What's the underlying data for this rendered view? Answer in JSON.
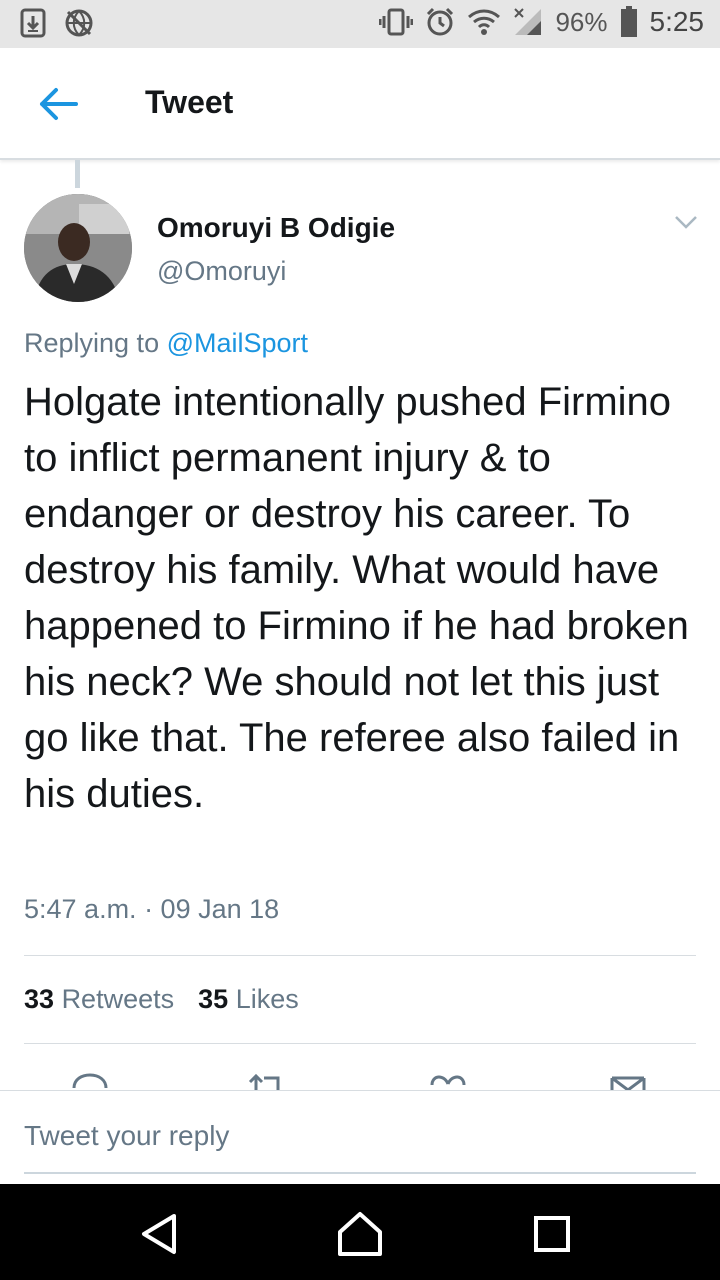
{
  "status_bar": {
    "battery": "96%",
    "time": "5:25",
    "icons": [
      "download-box-icon",
      "no-sim-globe-icon",
      "vibrate-icon",
      "alarm-icon",
      "wifi-icon",
      "signal-icon",
      "battery-icon"
    ]
  },
  "header": {
    "title": "Tweet",
    "back_icon": "arrow-left-icon"
  },
  "tweet": {
    "author_name": "Omoruyi B Odigie",
    "author_handle": "@Omoruyi",
    "replying_prefix": "Replying to ",
    "replying_to": "@MailSport",
    "text": "Holgate intentionally pushed Firmino to inflict permanent injury & to endanger or destroy his career. To destroy his family. What would have happened to Firmino if he had broken his neck? We should not let this just go like that. The referee also failed in his duties.",
    "timestamp": "5:47 a.m. · 09 Jan 18",
    "retweets_count": "33",
    "retweets_label": "Retweets",
    "likes_count": "35",
    "likes_label": "Likes"
  },
  "actions": [
    "reply-icon",
    "retweet-icon",
    "like-icon",
    "share-icon"
  ],
  "composer": {
    "placeholder": "Tweet your reply"
  },
  "nav": [
    "back-triangle-icon",
    "home-circle-icon",
    "recents-square-icon"
  ],
  "colors": {
    "accent": "#1b95e0",
    "text_primary": "#14171a",
    "text_secondary": "#657786",
    "divider": "#d8dde1",
    "status_bar_bg": "#e6e6e6",
    "nav_bar_bg": "#000000"
  }
}
